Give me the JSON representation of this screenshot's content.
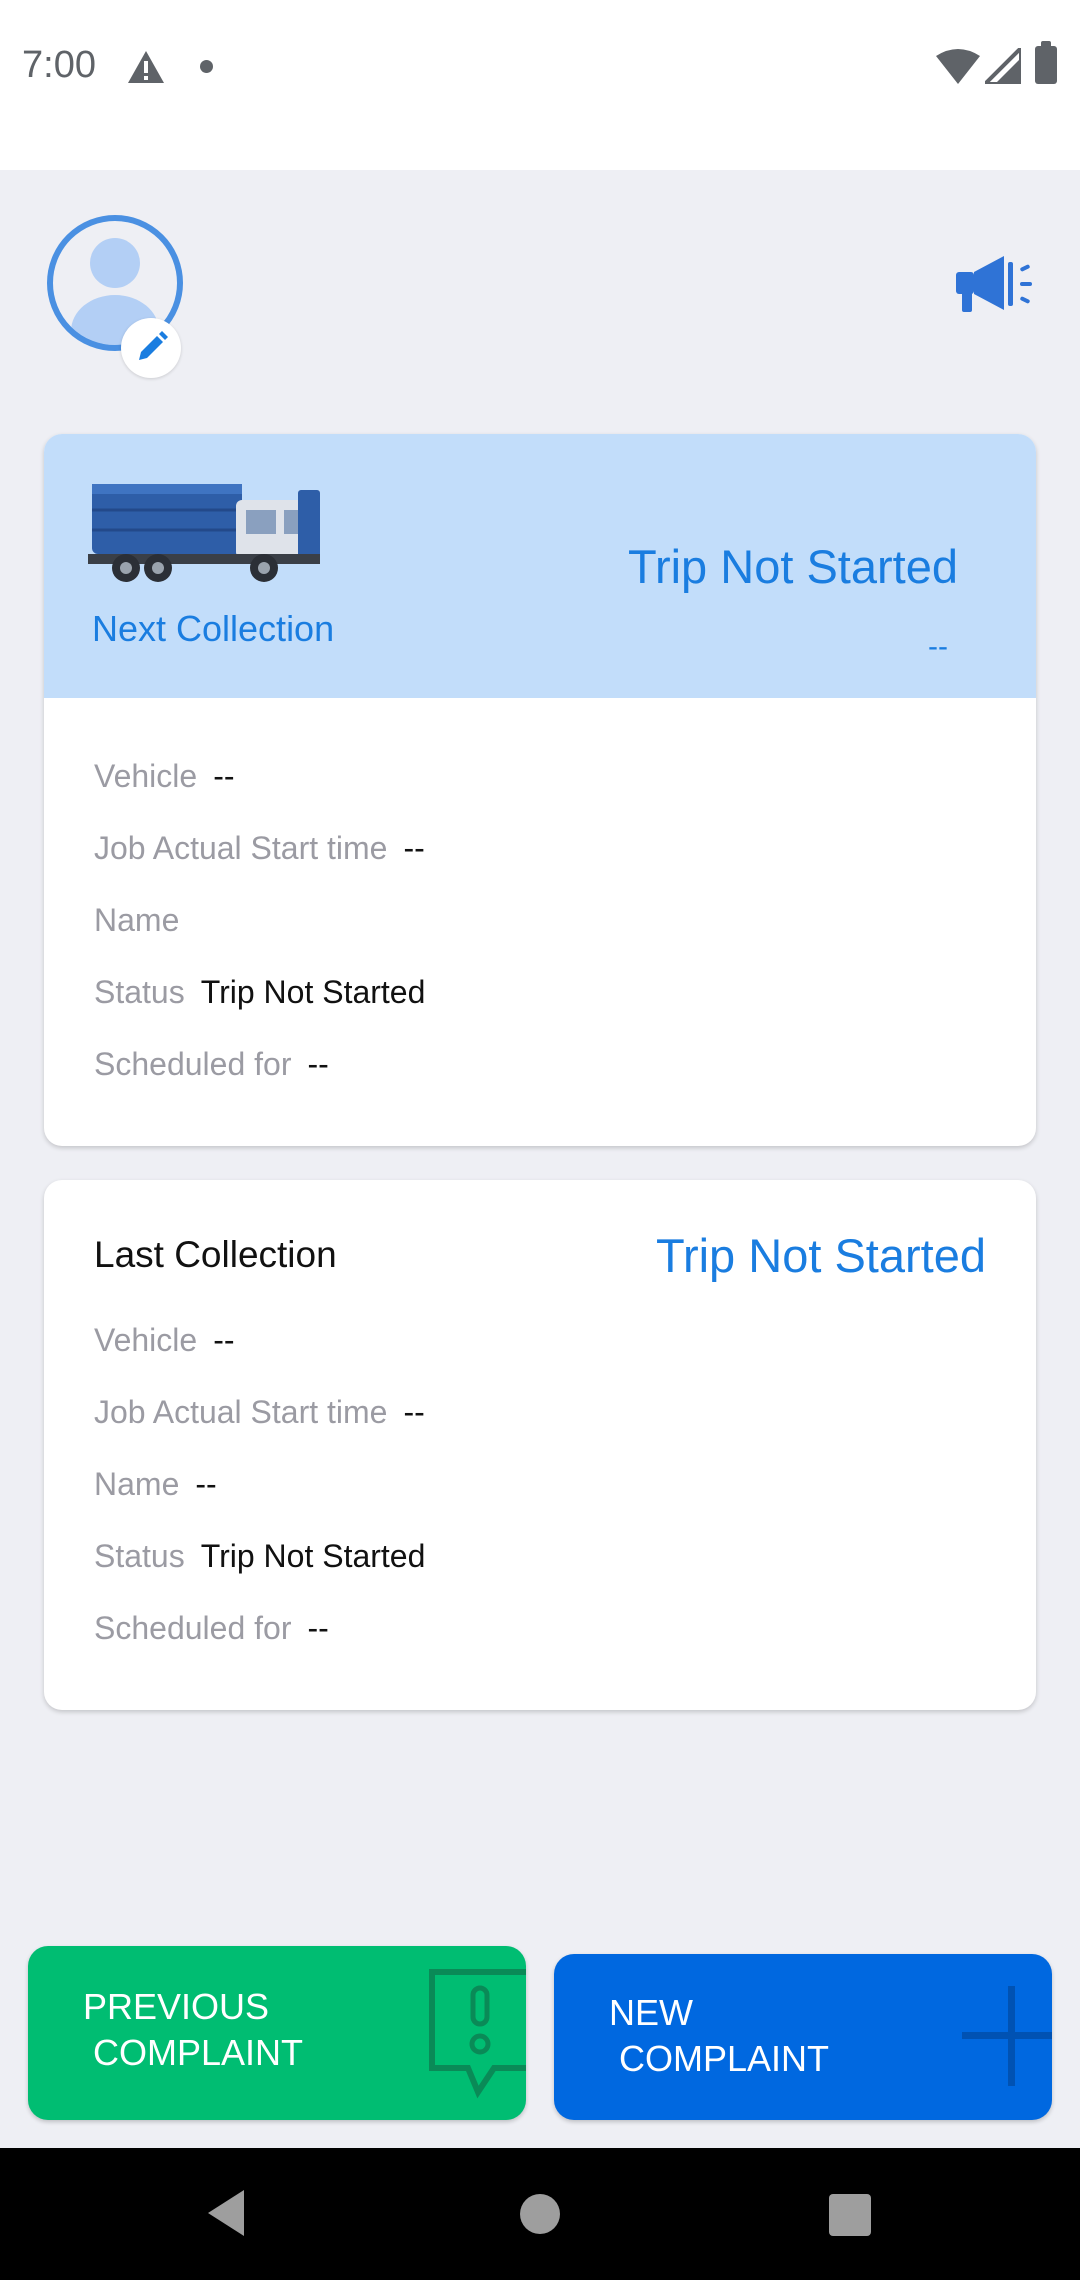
{
  "status_bar": {
    "time": "7:00",
    "icons": [
      "warning-icon",
      "notification-dot-icon",
      "wifi-icon",
      "cell-signal-icon",
      "battery-icon"
    ]
  },
  "header": {
    "avatar_icon": "user-avatar-icon",
    "edit_icon": "pencil-icon",
    "announcement_icon": "megaphone-icon"
  },
  "next_collection": {
    "label": "Next Collection",
    "trip_status": "Trip Not Started",
    "subtext": "--",
    "rows": [
      {
        "label": "Vehicle",
        "value": "--"
      },
      {
        "label": "Job Actual Start time",
        "value": "--"
      },
      {
        "label": "Name",
        "value": ""
      },
      {
        "label": "Status",
        "value": "Trip Not Started"
      },
      {
        "label": "Scheduled for",
        "value": "--"
      }
    ]
  },
  "last_collection": {
    "title": "Last Collection",
    "trip_status": "Trip Not Started",
    "rows": [
      {
        "label": "Vehicle",
        "value": "--"
      },
      {
        "label": "Job Actual Start time",
        "value": "--"
      },
      {
        "label": "Name",
        "value": "--"
      },
      {
        "label": "Status",
        "value": "Trip Not Started"
      },
      {
        "label": "Scheduled for",
        "value": "--"
      }
    ]
  },
  "buttons": {
    "previous_complaint": "PREVIOUS\n COMPLAINT",
    "new_complaint": "NEW\n COMPLAINT"
  },
  "colors": {
    "accent_blue": "#1a7de0",
    "header_blue": "#c2ddfa",
    "green": "#00bd72",
    "button_blue": "#0068e0",
    "background": "#eeeff4"
  }
}
